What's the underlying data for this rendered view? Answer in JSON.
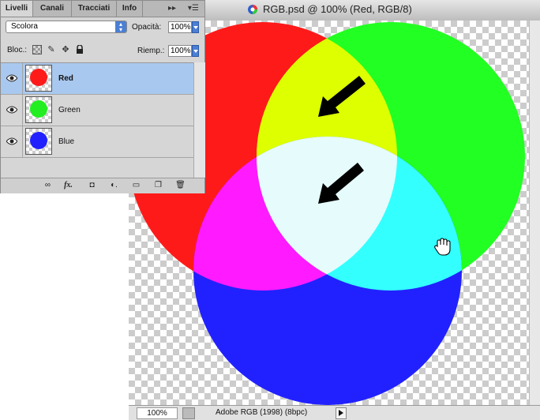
{
  "document": {
    "title": "RGB.psd @ 100% (Red, RGB/8)",
    "zoom": "100%",
    "profile": "Adobe RGB (1998) (8bpc)",
    "circle_colors": {
      "red": "#ff1a1a",
      "green": "#22ff22",
      "blue": "#2121ff",
      "yellow": "#ddff00",
      "magenta": "#ff1aff",
      "cyan": "#33ffff",
      "white": "#e6fbfb"
    }
  },
  "panel": {
    "tabs": [
      "Livelli",
      "Canali",
      "Tracciati",
      "Info"
    ],
    "blend_mode": "Scolora",
    "opacity_label": "Opacità:",
    "opacity_value": "100%",
    "lock_label": "Bloc.:",
    "fill_label": "Riemp.:",
    "fill_value": "100%",
    "layers": [
      {
        "name": "Red",
        "color": "#ff1a1a",
        "selected": true
      },
      {
        "name": "Green",
        "color": "#22ee22",
        "selected": false
      },
      {
        "name": "Blue",
        "color": "#2121ff",
        "selected": false
      }
    ],
    "footer_icons": [
      "link-icon",
      "fx-icon",
      "mask-icon",
      "adjustment-icon",
      "folder-icon",
      "new-layer-icon",
      "trash-icon"
    ]
  }
}
